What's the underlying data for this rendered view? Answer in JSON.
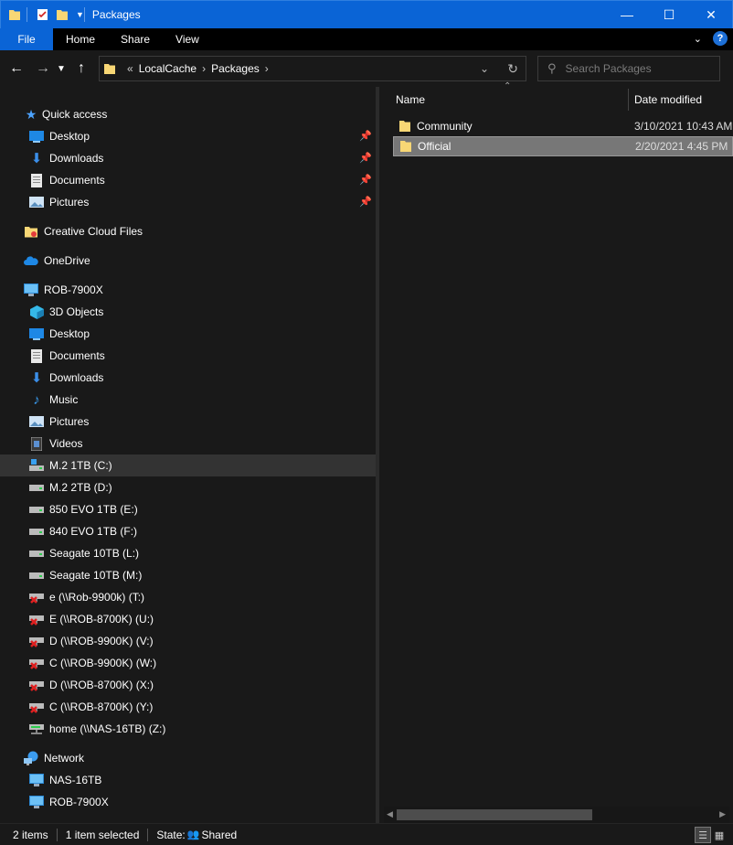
{
  "window": {
    "title": "Packages"
  },
  "ribbon": {
    "file_tab": "File",
    "tabs": [
      "Home",
      "Share",
      "View"
    ],
    "help_label": "?"
  },
  "address": {
    "overflow_marker": "«",
    "crumbs": [
      "LocalCache",
      "Packages"
    ]
  },
  "search": {
    "placeholder": "Search Packages"
  },
  "nav": {
    "quick_access": "Quick access",
    "qa_items": [
      "Desktop",
      "Downloads",
      "Documents",
      "Pictures"
    ],
    "creative_cloud": "Creative Cloud Files",
    "onedrive": "OneDrive",
    "this_pc": "ROB-7900X",
    "pc_items": [
      "3D Objects",
      "Desktop",
      "Documents",
      "Downloads",
      "Music",
      "Pictures",
      "Videos"
    ],
    "drives": [
      "M.2 1TB (C:)",
      "M.2 2TB (D:)",
      "850 EVO 1TB (E:)",
      "840 EVO 1TB (F:)",
      "Seagate 10TB (L:)",
      "Seagate 10TB (M:)",
      "e (\\\\Rob-9900k) (T:)",
      "E (\\\\ROB-8700K) (U:)",
      "D (\\\\ROB-9900K) (V:)",
      "C (\\\\ROB-9900K) (W:)",
      "D (\\\\ROB-8700K) (X:)",
      "C (\\\\ROB-8700K) (Y:)",
      "home (\\\\NAS-16TB) (Z:)"
    ],
    "network": "Network",
    "network_items": [
      "NAS-16TB",
      "ROB-7900X"
    ]
  },
  "files": {
    "col_name": "Name",
    "col_date": "Date modified",
    "rows": [
      {
        "name": "Community",
        "date": "3/10/2021 10:43 AM"
      },
      {
        "name": "Official",
        "date": "2/20/2021 4:45 PM"
      }
    ]
  },
  "status": {
    "count": "2 items",
    "selected": "1 item selected",
    "state_label": "State:",
    "state_value": "Shared"
  },
  "colors": {
    "accent": "#0a64d6",
    "folder": "#f8d775",
    "background": "#191919",
    "selected_row": "#777777"
  }
}
